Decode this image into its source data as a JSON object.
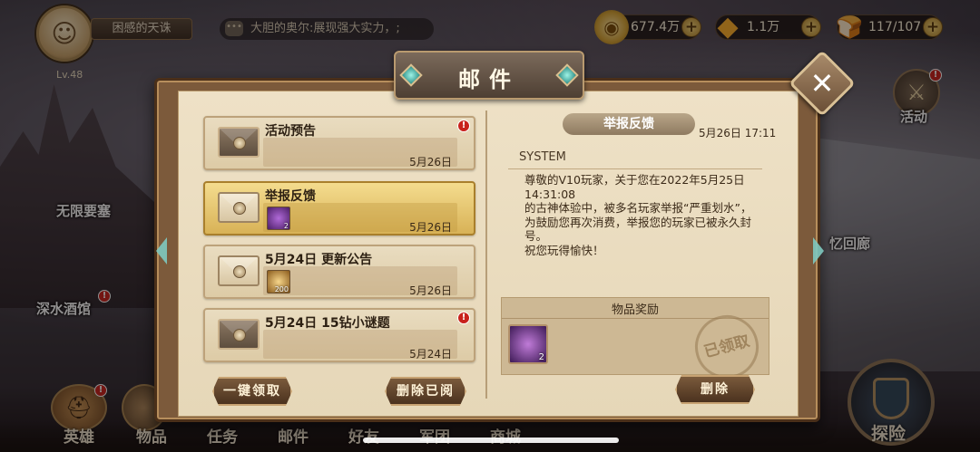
{
  "player": {
    "name": "困感的天诛",
    "level": "Lv.48"
  },
  "chat": {
    "message": "大胆的奥尔:展现强大实力，;"
  },
  "resources": [
    {
      "name": "gold",
      "value": "677.4万"
    },
    {
      "name": "diamond",
      "value": "1.1万"
    },
    {
      "name": "stamina",
      "value": "117/107"
    }
  ],
  "background_labels": {
    "fortress": "无限要塞",
    "tavern": "深水酒馆",
    "activity": "活动",
    "memory": "忆回廊"
  },
  "bottom_nav": {
    "hero": "英雄",
    "items": "物品",
    "tasks": "任务",
    "mail": "邮件",
    "friends": "好友",
    "clan": "军团",
    "market": "商城",
    "explore": "探险"
  },
  "dialog": {
    "title": "邮件",
    "close_label": "✕",
    "claim_all_label": "一键领取",
    "delete_read_label": "删除已阅",
    "delete_label": "删除"
  },
  "mails": [
    {
      "subject": "活动预告",
      "date": "5月26日",
      "unread": true,
      "has_item": false
    },
    {
      "subject": "举报反馈",
      "date": "5月26日",
      "unread": false,
      "has_item": true,
      "item_qty": "2"
    },
    {
      "subject": "5月24日 更新公告",
      "date": "5月26日",
      "unread": false,
      "has_item": true,
      "item_qty": "200"
    },
    {
      "subject": "5月24日 15钻小谜题",
      "date": "5月24日",
      "unread": true,
      "has_item": false
    }
  ],
  "detail": {
    "title": "举报反馈",
    "time": "5月26日 17:11",
    "sender": "SYSTEM",
    "body": "尊敬的V10玩家，关于您在2022年5月25日14:31:08\n的古神体验中，被多名玩家举报“严重划水”，为鼓励您再次消费，举报您的玩家已被永久封号。\n祝您玩得愉快！",
    "reward_header": "物品奖励",
    "reward_qty": "2",
    "claimed_stamp": "已领取"
  }
}
